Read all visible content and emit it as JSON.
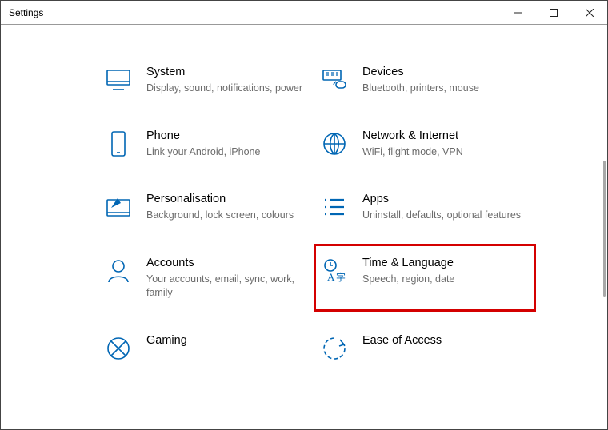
{
  "window": {
    "title": "Settings"
  },
  "accent": "#0066b4",
  "highlightColor": "#d40000",
  "items": [
    {
      "id": "system",
      "icon": "system-icon",
      "label": "System",
      "desc": "Display, sound, notifications, power"
    },
    {
      "id": "devices",
      "icon": "devices-icon",
      "label": "Devices",
      "desc": "Bluetooth, printers, mouse"
    },
    {
      "id": "phone",
      "icon": "phone-icon",
      "label": "Phone",
      "desc": "Link your Android, iPhone"
    },
    {
      "id": "network",
      "icon": "network-icon",
      "label": "Network & Internet",
      "desc": "WiFi, flight mode, VPN"
    },
    {
      "id": "personalisation",
      "icon": "personalisation-icon",
      "label": "Personalisation",
      "desc": "Background, lock screen, colours"
    },
    {
      "id": "apps",
      "icon": "apps-icon",
      "label": "Apps",
      "desc": "Uninstall, defaults, optional features"
    },
    {
      "id": "accounts",
      "icon": "accounts-icon",
      "label": "Accounts",
      "desc": "Your accounts, email, sync, work, family"
    },
    {
      "id": "time-language",
      "icon": "time-language-icon",
      "label": "Time & Language",
      "desc": "Speech, region, date",
      "highlighted": true
    },
    {
      "id": "gaming",
      "icon": "gaming-icon",
      "label": "Gaming",
      "desc": ""
    },
    {
      "id": "ease-of-access",
      "icon": "ease-of-access-icon",
      "label": "Ease of Access",
      "desc": ""
    }
  ]
}
